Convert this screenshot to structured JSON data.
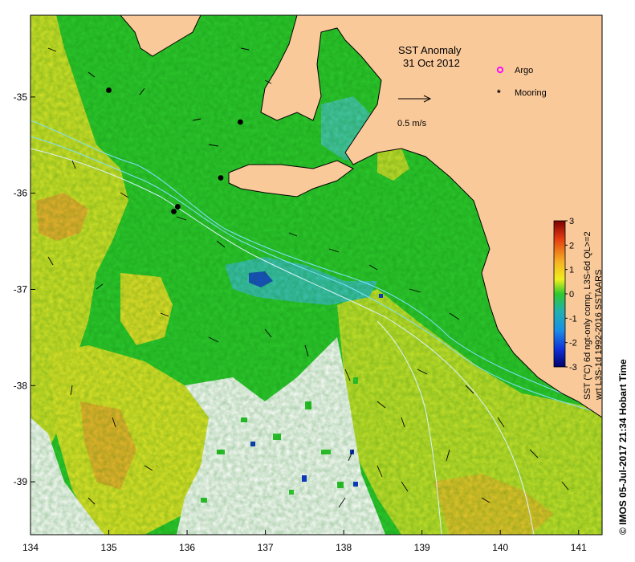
{
  "map": {
    "lon_range": [
      134,
      141.3
    ],
    "lat_range": [
      -39.55,
      -34.15
    ],
    "x_ticks": [
      134,
      135,
      136,
      137,
      138,
      139,
      140,
      141
    ],
    "y_ticks": [
      -35,
      -36,
      -37,
      -38,
      -39
    ],
    "x_tick_labels": [
      "134",
      "135",
      "136",
      "137",
      "138",
      "139",
      "140",
      "141"
    ],
    "y_tick_labels": [
      "-35",
      "-36",
      "-37",
      "-38",
      "-39"
    ]
  },
  "title": {
    "line1": "SST Anomaly",
    "line2": "31 Oct 2012"
  },
  "scale_arrow": {
    "label": "0.5 m/s"
  },
  "legend": {
    "argo": {
      "label": "Argo",
      "color": "#ff00ff"
    },
    "mooring": {
      "label": "Mooring",
      "color": "#000000"
    }
  },
  "colorbar": {
    "min": -3,
    "max": 3,
    "tick_labels": [
      "3",
      "2",
      "1",
      "0",
      "-1",
      "-2",
      "-3"
    ],
    "title_line1": "SST (°C) 6d ngt-only comp, L3S-6d QL>=2",
    "title_line2": "wrt L3S-1d 1992-2016 SSTAARS"
  },
  "credit": "© IMOS 05-Jul-2017 21:34 Hobart Time",
  "colors": {
    "land": "#f9c99a",
    "ocean_nodata": "#ffffff",
    "anomaly_green": "#2ec92e",
    "anomaly_yellow": "#e7e326",
    "anomaly_orange": "#ef9a2a",
    "anomaly_cyan": "#37c6c6",
    "anomaly_blue": "#1030c0",
    "contour": "#7fe0ff"
  },
  "moorings": [
    {
      "lon": 135.0,
      "lat": -34.93
    },
    {
      "lon": 136.68,
      "lat": -35.26
    },
    {
      "lon": 136.43,
      "lat": -35.84
    },
    {
      "lon": 135.88,
      "lat": -36.14
    },
    {
      "lon": 135.83,
      "lat": -36.19
    }
  ]
}
